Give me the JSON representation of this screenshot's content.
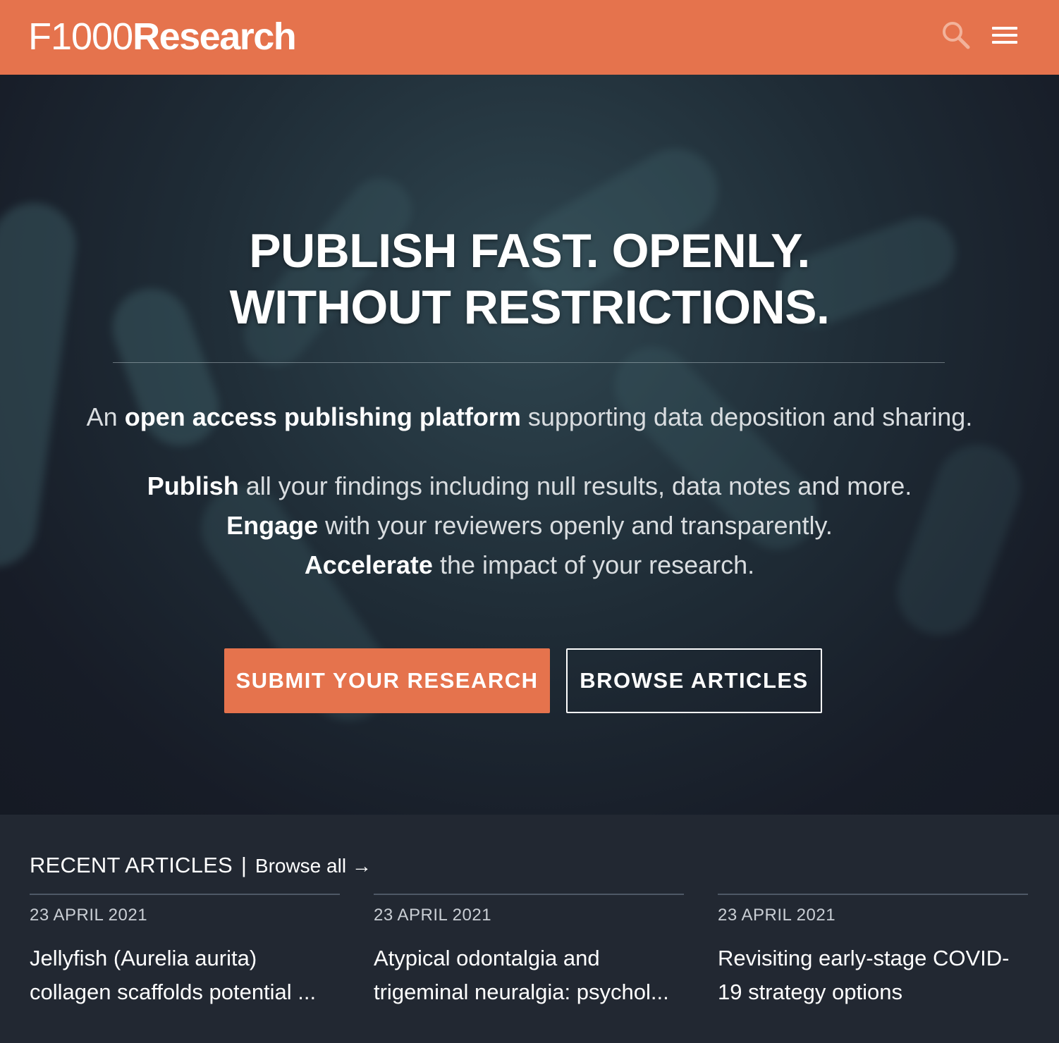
{
  "header": {
    "logo_thin": "F1000",
    "logo_bold": "Research",
    "accent_color": "#e5734d"
  },
  "hero": {
    "headline_line1": "PUBLISH FAST. OPENLY.",
    "headline_line2": "WITHOUT RESTRICTIONS.",
    "tagline": {
      "prefix": "An",
      "bold": "open access publishing platform",
      "suffix": "supporting data deposition and sharing."
    },
    "points": [
      {
        "bold": "Publish",
        "text": "all your findings including null results, data notes and more."
      },
      {
        "bold": "Engage",
        "text": "with your reviewers openly and transparently."
      },
      {
        "bold": "Accelerate",
        "text": "the impact of your research."
      }
    ],
    "submit_label": "SUBMIT YOUR RESEARCH",
    "browse_label": "BROWSE ARTICLES"
  },
  "recent": {
    "title": "RECENT ARTICLES",
    "separator": "|",
    "browse_all": "Browse all",
    "arrow": "→",
    "articles": [
      {
        "date": "23 APRIL 2021",
        "line1": "Jellyfish (Aurelia aurita)",
        "line2": "collagen scaffolds potential ..."
      },
      {
        "date": "23 APRIL 2021",
        "line1": "Atypical odontalgia and",
        "line2": "trigeminal neuralgia: psychol..."
      },
      {
        "date": "23 APRIL 2021",
        "line1": "Revisiting early-stage COVID-",
        "line2": "19 strategy options"
      }
    ]
  }
}
